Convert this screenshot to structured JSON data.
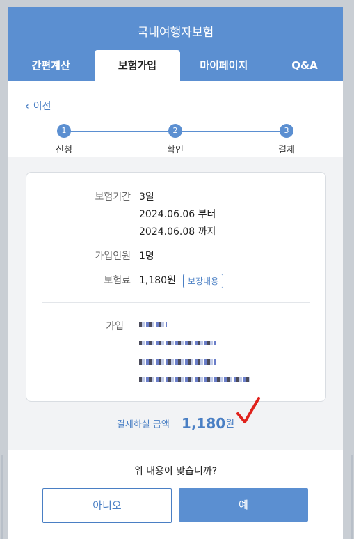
{
  "header": {
    "title": "국내여행자보험",
    "tabs": [
      "간편계산",
      "보험가입",
      "마이페이지",
      "Q&A"
    ]
  },
  "back_label": "이전",
  "steps": [
    {
      "num": "1",
      "label": "신청"
    },
    {
      "num": "2",
      "label": "확인"
    },
    {
      "num": "3",
      "label": "결제"
    }
  ],
  "details": {
    "period_label": "보험기간",
    "period_days": "3일",
    "period_start": "2024.06.06 부터",
    "period_end": "2024.06.08 까지",
    "members_label": "가입인원",
    "members_value": "1명",
    "premium_label": "보험료",
    "premium_value": "1,180원",
    "coverage_button": "보장내용",
    "subscriber_label": "가입"
  },
  "payment": {
    "label": "결제하실 금액",
    "amount": "1,180",
    "unit": "원"
  },
  "confirm": {
    "question": "위 내용이 맞습니까?",
    "no": "아니오",
    "yes": "예"
  },
  "colors": {
    "accent": "#5b8fd1",
    "link": "#4a7fc4",
    "check": "#e0221c"
  }
}
